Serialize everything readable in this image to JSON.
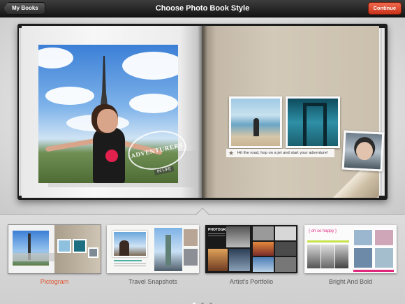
{
  "navbar": {
    "back_label": "My Books",
    "title": "Choose Photo Book Style",
    "continue_label": "Continue"
  },
  "preview": {
    "stamp_text": "ADVENTURERS",
    "stamp_sub": "IN LIFE",
    "caption": "Hit the road, hop on a jet and start your adventure!"
  },
  "styles": [
    {
      "label": "Pictogram",
      "selected": true
    },
    {
      "label": "Travel Snapshots",
      "selected": false
    },
    {
      "label": "Artist's Portfolio",
      "selected": false
    },
    {
      "label": "Bright And Bold",
      "selected": false
    }
  ],
  "thumb_text": {
    "artist_heading": "PHOTOGRAPHY",
    "bright_heading": "{ oh so happy }"
  },
  "pager": {
    "current": 1,
    "total": 3
  },
  "colors": {
    "accent": "#e0532f",
    "continue_button": "#d9442a",
    "navbar": "#1f1f1f"
  }
}
